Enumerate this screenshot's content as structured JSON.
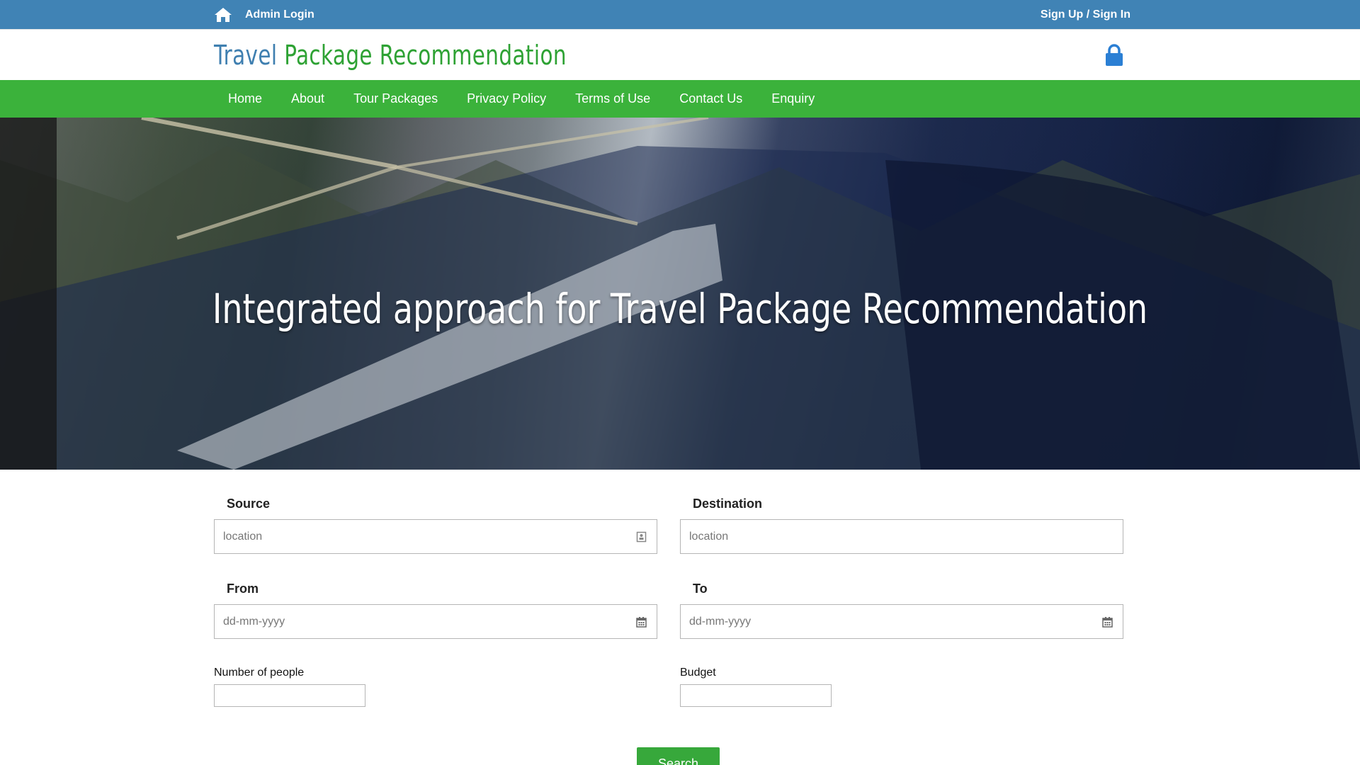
{
  "topbar": {
    "admin_login": "Admin Login",
    "signup_signin": "Sign Up / Sign In",
    "home_icon": "home-icon"
  },
  "header": {
    "logo_word1": "Travel",
    "logo_word2": "Package Recommendation",
    "lock_icon": "lock-icon",
    "colors": {
      "blue": "#3f7fb0",
      "green": "#2ea234"
    }
  },
  "nav": {
    "items": [
      "Home",
      "About",
      "Tour Packages",
      "Privacy Policy",
      "Terms of Use",
      "Contact Us",
      "Enquiry"
    ]
  },
  "hero": {
    "title": "Integrated approach for Travel Package Recommendation"
  },
  "form": {
    "source_label": "Source",
    "source_placeholder": "location",
    "destination_label": "Destination",
    "destination_placeholder": "location",
    "from_label": "From",
    "from_placeholder": "dd-mm-yyyy",
    "to_label": "To",
    "to_placeholder": "dd-mm-yyyy",
    "people_label": "Number of people",
    "budget_label": "Budget",
    "search_label": "Search"
  },
  "colors": {
    "topbar": "#4083b5",
    "nav": "#3bb23b",
    "button": "#37a83b"
  }
}
